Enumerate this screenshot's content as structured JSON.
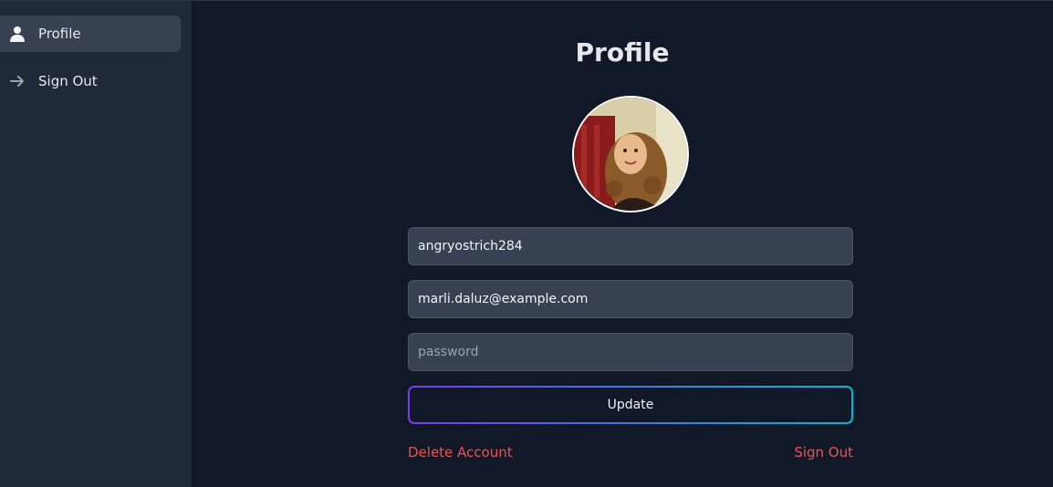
{
  "sidebar": {
    "items": [
      {
        "label": "Profile",
        "icon": "user-icon",
        "active": true
      },
      {
        "label": "Sign Out",
        "icon": "arrow-right-icon",
        "active": false
      }
    ]
  },
  "main": {
    "title": "Profile",
    "username_value": "angryostrich284",
    "email_value": "marli.daluz@example.com",
    "password_placeholder": "password",
    "update_label": "Update",
    "delete_label": "Delete Account",
    "signout_label": "Sign Out"
  },
  "colors": {
    "background": "#111827",
    "sidebar": "#1f2937",
    "input": "#374151",
    "danger": "#f05252",
    "gradient_start": "#7c3aed",
    "gradient_end": "#06b6d4"
  }
}
